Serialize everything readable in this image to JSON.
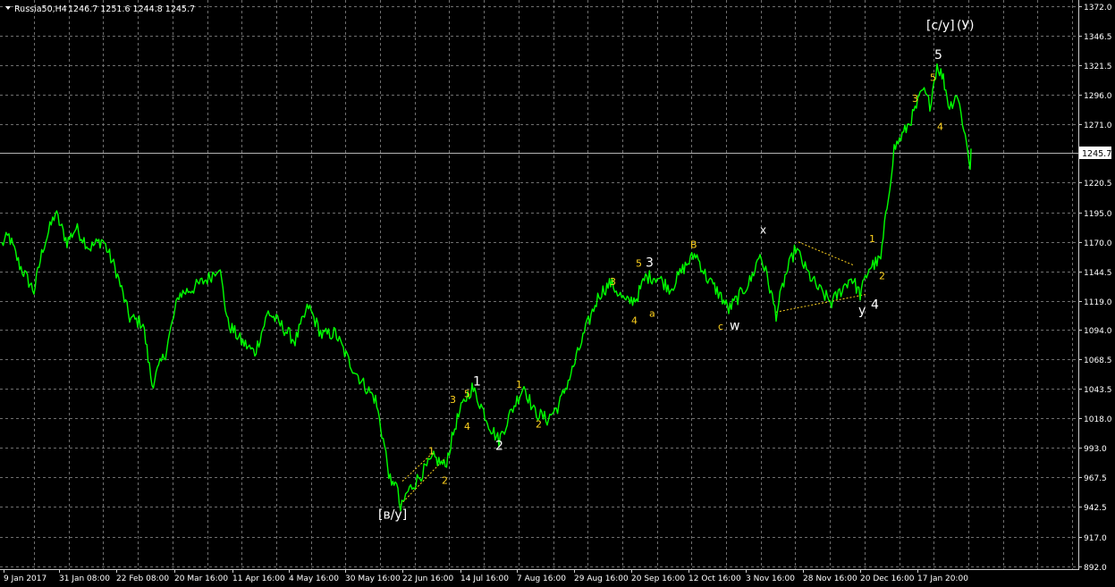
{
  "header": {
    "symbol": "Russia50,H4",
    "ohlc": "1246.7 1251.6 1244.8 1245.7"
  },
  "price_axis": {
    "ticks": [
      "1372.0",
      "1346.5",
      "1321.5",
      "1296.0",
      "1271.0",
      "1245.7",
      "1220.5",
      "1195.0",
      "1170.0",
      "1144.5",
      "1119.0",
      "1094.0",
      "1068.5",
      "1043.5",
      "1018.0",
      "993.0",
      "967.5",
      "942.5",
      "917.0",
      "892.0"
    ],
    "current": "1245.7"
  },
  "time_axis": {
    "ticks": [
      "9 Jan 2017",
      "31 Jan 08:00",
      "22 Feb 08:00",
      "20 Mar 16:00",
      "11 Apr 16:00",
      "4 May 16:00",
      "30 May 16:00",
      "22 Jun 16:00",
      "14 Jul 16:00",
      "7 Aug 16:00",
      "29 Aug 16:00",
      "20 Sep 16:00",
      "12 Oct 16:00",
      "3 Nov 16:00",
      "28 Nov 16:00",
      "20 Dec 16:00",
      "17 Jan 20:00"
    ]
  },
  "colors": {
    "background": "#000000",
    "price_line": "#00ff00",
    "grid": "#b4b4b4",
    "wave_yellow": "#ffd21e",
    "wave_white": "#ffffff",
    "axis_text": "#ffffff"
  },
  "chart_data": {
    "type": "line",
    "title": "Russia50,H4",
    "ylim": [
      892.0,
      1372.0
    ],
    "series": [
      {
        "x": [
          "9 Jan 2017",
          "31 Jan 08:00",
          "22 Feb 08:00",
          "20 Mar 16:00",
          "11 Apr 16:00",
          "4 May 16:00",
          "30 May 16:00",
          "22 Jun 16:00",
          "14 Jul 16:00",
          "7 Aug 16:00",
          "29 Aug 16:00",
          "20 Sep 16:00",
          "12 Oct 16:00",
          "3 Nov 16:00",
          "28 Nov 16:00",
          "20 Dec 16:00",
          "17 Jan 20:00"
        ],
        "y": [
          1172,
          1185,
          1105,
          1130,
          1080,
          1105,
          1030,
          950,
          1040,
          1025,
          1110,
          1135,
          1130,
          1145,
          1140,
          1160,
          1300
        ]
      }
    ],
    "last_price": 1245.7,
    "wave_labels": [
      {
        "text": "[c/y]",
        "color": "white"
      },
      {
        "text": "(У)",
        "color": "white"
      },
      {
        "text": "5",
        "color": "white"
      },
      {
        "text": "5",
        "color": "yellow"
      },
      {
        "text": "3",
        "color": "yellow"
      },
      {
        "text": "4",
        "color": "yellow"
      },
      {
        "text": "B",
        "color": "yellow"
      },
      {
        "text": "x",
        "color": "white"
      },
      {
        "text": "1",
        "color": "yellow"
      },
      {
        "text": "2",
        "color": "yellow"
      },
      {
        "text": "y",
        "color": "white"
      },
      {
        "text": "4",
        "color": "white"
      },
      {
        "text": "c",
        "color": "yellow"
      },
      {
        "text": "w",
        "color": "white"
      },
      {
        "text": "5",
        "color": "yellow"
      },
      {
        "text": "3",
        "color": "white"
      },
      {
        "text": "3",
        "color": "yellow"
      },
      {
        "text": "4",
        "color": "yellow"
      },
      {
        "text": "a",
        "color": "yellow"
      },
      {
        "text": "1",
        "color": "white"
      },
      {
        "text": "5",
        "color": "yellow"
      },
      {
        "text": "3",
        "color": "yellow"
      },
      {
        "text": "4",
        "color": "yellow"
      },
      {
        "text": "1",
        "color": "yellow"
      },
      {
        "text": "2",
        "color": "yellow"
      },
      {
        "text": "2",
        "color": "white"
      },
      {
        "text": "1",
        "color": "yellow"
      },
      {
        "text": "2",
        "color": "yellow"
      },
      {
        "text": "[в/у]",
        "color": "white"
      }
    ]
  }
}
